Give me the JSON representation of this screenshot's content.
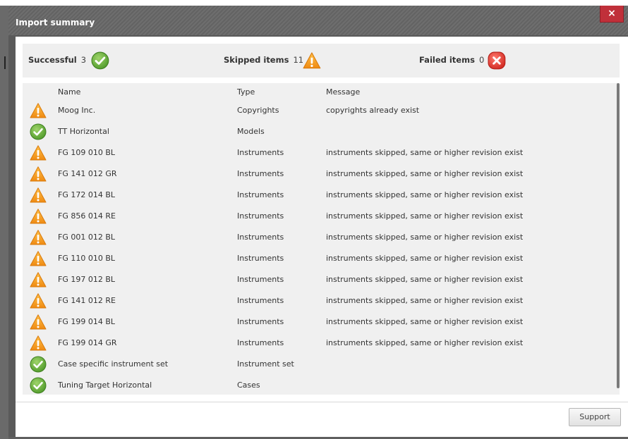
{
  "dialog": {
    "title": "Import summary",
    "close_label": "×"
  },
  "summary": {
    "successful": {
      "label": "Successful",
      "count": "3",
      "icon": "success-icon"
    },
    "skipped": {
      "label": "Skipped items",
      "count": "11",
      "icon": "warning-icon"
    },
    "failed": {
      "label": "Failed items",
      "count": "0",
      "icon": "error-icon"
    }
  },
  "table": {
    "headers": {
      "name": "Name",
      "type": "Type",
      "message": "Message"
    },
    "rows": [
      {
        "status": "warning",
        "name": "Moog Inc.",
        "type": "Copyrights",
        "message": "copyrights already exist"
      },
      {
        "status": "success",
        "name": "TT Horizontal",
        "type": "Models",
        "message": ""
      },
      {
        "status": "warning",
        "name": "FG 109 010 BL",
        "type": "Instruments",
        "message": "instruments skipped, same or higher revision exist"
      },
      {
        "status": "warning",
        "name": "FG 141 012 GR",
        "type": "Instruments",
        "message": "instruments skipped, same or higher revision exist"
      },
      {
        "status": "warning",
        "name": "FG 172 014 BL",
        "type": "Instruments",
        "message": "instruments skipped, same or higher revision exist"
      },
      {
        "status": "warning",
        "name": "FG 856 014 RE",
        "type": "Instruments",
        "message": "instruments skipped, same or higher revision exist"
      },
      {
        "status": "warning",
        "name": "FG 001 012 BL",
        "type": "Instruments",
        "message": "instruments skipped, same or higher revision exist"
      },
      {
        "status": "warning",
        "name": "FG 110 010 BL",
        "type": "Instruments",
        "message": "instruments skipped, same or higher revision exist"
      },
      {
        "status": "warning",
        "name": "FG 197 012 BL",
        "type": "Instruments",
        "message": "instruments skipped, same or higher revision exist"
      },
      {
        "status": "warning",
        "name": "FG 141 012 RE",
        "type": "Instruments",
        "message": "instruments skipped, same or higher revision exist"
      },
      {
        "status": "warning",
        "name": "FG 199 014 BL",
        "type": "Instruments",
        "message": "instruments skipped, same or higher revision exist"
      },
      {
        "status": "warning",
        "name": "FG 199 014 GR",
        "type": "Instruments",
        "message": "instruments skipped, same or higher revision exist"
      },
      {
        "status": "success",
        "name": "Case specific instrument set",
        "type": "Instrument set",
        "message": ""
      },
      {
        "status": "success",
        "name": "Tuning Target Horizontal",
        "type": "Cases",
        "message": ""
      }
    ]
  },
  "footer": {
    "support_label": "Support"
  },
  "colors": {
    "success": "#6cb33f",
    "warning": "#f39c12",
    "error": "#e53935",
    "close": "#c0303a"
  }
}
